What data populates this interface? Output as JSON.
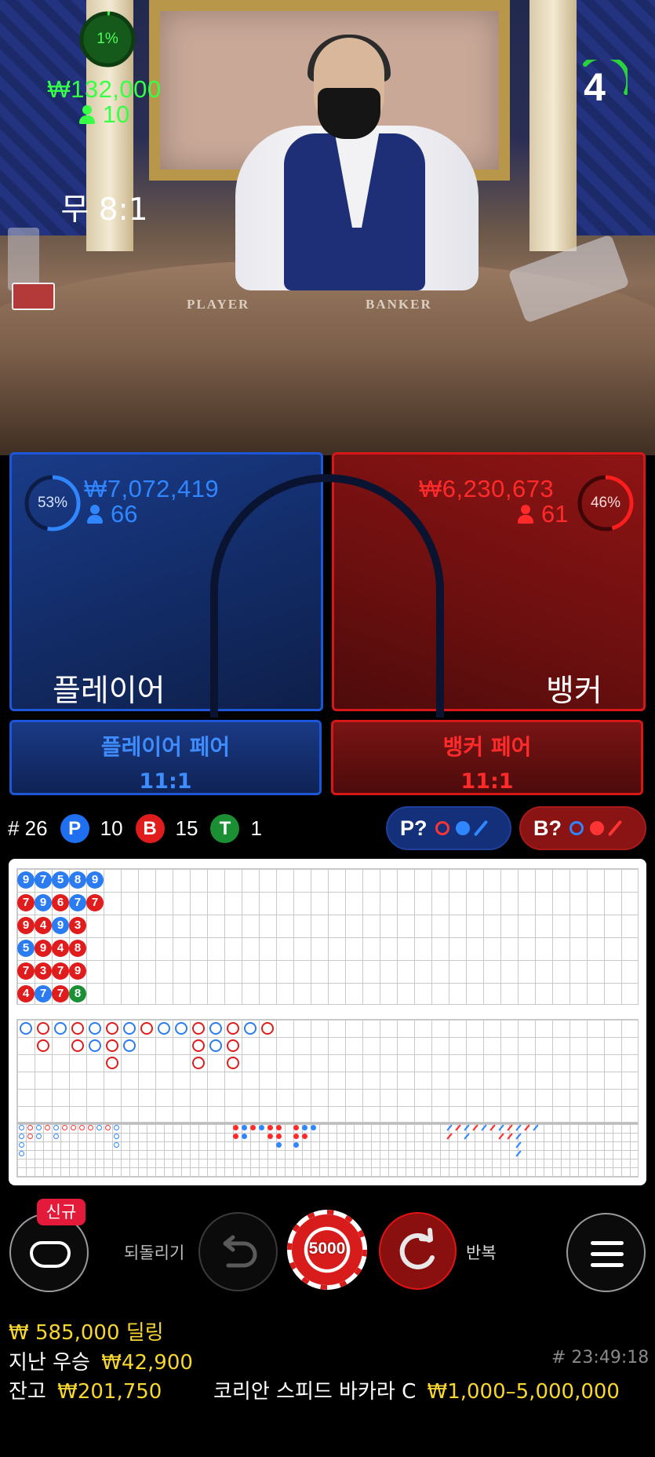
{
  "timer": {
    "value": "4"
  },
  "video": {
    "table_player_label": "PLAYER",
    "table_banker_label": "BANKER"
  },
  "bets": {
    "player": {
      "percent": "53%",
      "amount": "₩7,072,419",
      "count": "66",
      "name": "플레이어",
      "color": "#1d56d8"
    },
    "tie": {
      "percent": "1%",
      "amount": "₩132,000",
      "count": "10",
      "name": "무 8:1",
      "color": "#2fd23d"
    },
    "banker": {
      "percent": "46%",
      "amount": "₩6,230,673",
      "count": "61",
      "name": "뱅커",
      "color": "#d81818"
    },
    "player_pair": {
      "name": "플레이어 페어",
      "odds": "11:1"
    },
    "banker_pair": {
      "name": "뱅커 페어",
      "odds": "11:1"
    }
  },
  "stats": {
    "round": "# 26",
    "player_letter": "P",
    "player_count": "10",
    "banker_letter": "B",
    "banker_count": "15",
    "tie_letter": "T",
    "tie_count": "1",
    "player_predict": "P?",
    "banker_predict": "B?"
  },
  "roadmap": {
    "bead_plate": [
      [
        {
          "n": "9",
          "c": "P"
        },
        {
          "n": "7",
          "c": "B"
        },
        {
          "n": "9",
          "c": "B"
        },
        {
          "n": "5",
          "c": "P"
        },
        {
          "n": "7",
          "c": "B"
        },
        {
          "n": "4",
          "c": "B"
        }
      ],
      [
        {
          "n": "7",
          "c": "P"
        },
        {
          "n": "9",
          "c": "P"
        },
        {
          "n": "4",
          "c": "B"
        },
        {
          "n": "9",
          "c": "B"
        },
        {
          "n": "3",
          "c": "B"
        },
        {
          "n": "7",
          "c": "P"
        }
      ],
      [
        {
          "n": "5",
          "c": "P"
        },
        {
          "n": "6",
          "c": "B"
        },
        {
          "n": "9",
          "c": "P"
        },
        {
          "n": "4",
          "c": "B"
        },
        {
          "n": "7",
          "c": "B"
        },
        {
          "n": "7",
          "c": "B"
        }
      ],
      [
        {
          "n": "8",
          "c": "P"
        },
        {
          "n": "7",
          "c": "P"
        },
        {
          "n": "3",
          "c": "B"
        },
        {
          "n": "8",
          "c": "B"
        },
        {
          "n": "9",
          "c": "B"
        },
        {
          "n": "8",
          "c": "T"
        }
      ],
      [
        {
          "n": "9",
          "c": "P"
        },
        {
          "n": "7",
          "c": "B"
        }
      ]
    ],
    "big_road": [
      [
        "P"
      ],
      [
        "B",
        "B"
      ],
      [
        "P"
      ],
      [
        "B",
        "B"
      ],
      [
        "P",
        "P"
      ],
      [
        "B",
        "B",
        "B"
      ],
      [
        "P",
        "P"
      ],
      [
        "B"
      ],
      [
        "P"
      ],
      [
        "P"
      ],
      [
        "B",
        "B",
        "B"
      ],
      [
        "P",
        "P"
      ],
      [
        "B",
        "B",
        "B"
      ],
      [
        "P"
      ],
      [
        "B"
      ]
    ]
  },
  "controls": {
    "new_badge": "신규",
    "undo_label": "되돌리기",
    "chip_value": "5000",
    "repeat_label": "반복"
  },
  "footer": {
    "dealing_amount": "₩ 585,000",
    "dealing_label": "딜링",
    "last_win_label": "지난 우승",
    "last_win_amount": "₩42,900",
    "time": "# 23:49:18",
    "balance_label": "잔고",
    "balance_amount": "₩201,750",
    "table_name": "코리안 스피드 바카라 C",
    "limits": "₩1,000–5,000,000"
  }
}
